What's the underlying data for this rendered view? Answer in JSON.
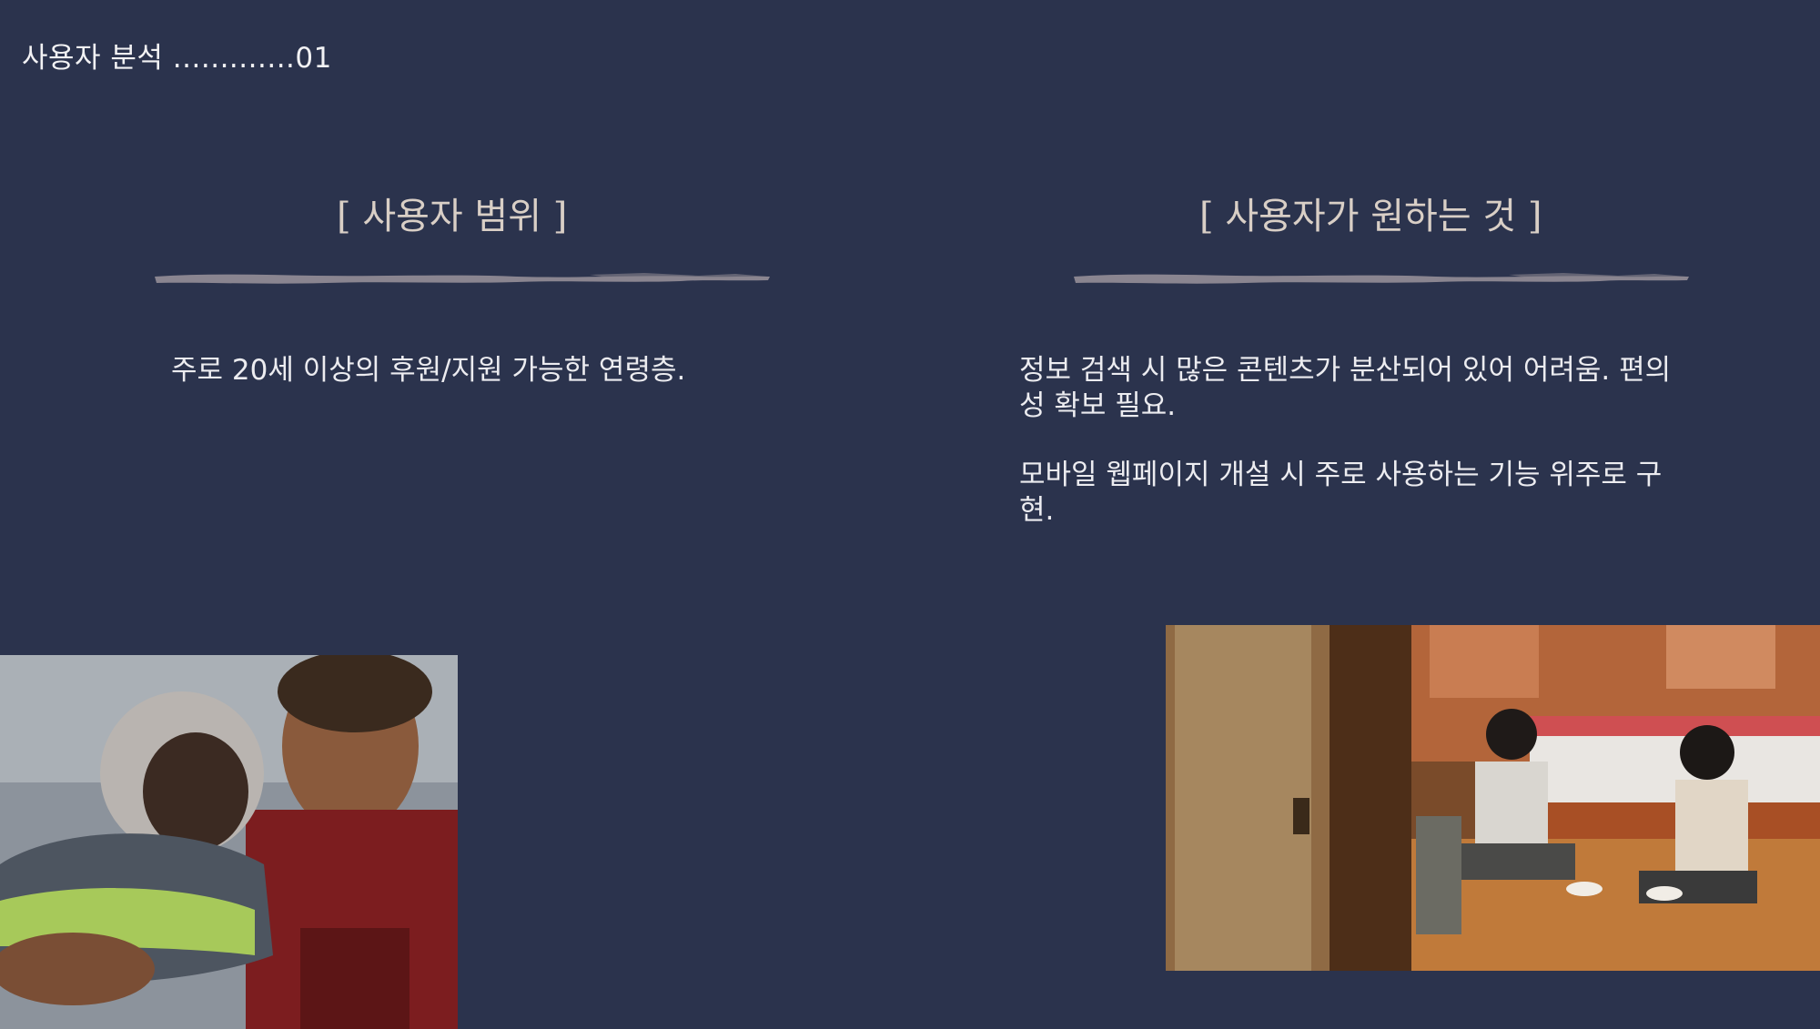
{
  "slide": {
    "section_label": "사용자 분석 .............01",
    "background_color": "#2b334d"
  },
  "left_column": {
    "heading": "[ 사용자 범위 ]",
    "text": "주로 20세 이상의 후원/지원 가능한 연령층."
  },
  "right_column": {
    "heading": "[ 사용자가 원하는 것 ]",
    "paragraphs": [
      "  정보 검색 시 많은 콘텐츠가 분산되어 있어 어려움. 편의성 확보 필요.",
      "  모바일 웹페이지 개설 시 주로 사용하는 기능 위주로 구현."
    ]
  },
  "images": {
    "left_photo": "photo-rescuer-holding-child",
    "right_photo": "photo-children-eating-in-room"
  },
  "colors": {
    "heading": "#d9cfc6",
    "brush_stroke": "#8a8590",
    "text": "#ececf0"
  }
}
